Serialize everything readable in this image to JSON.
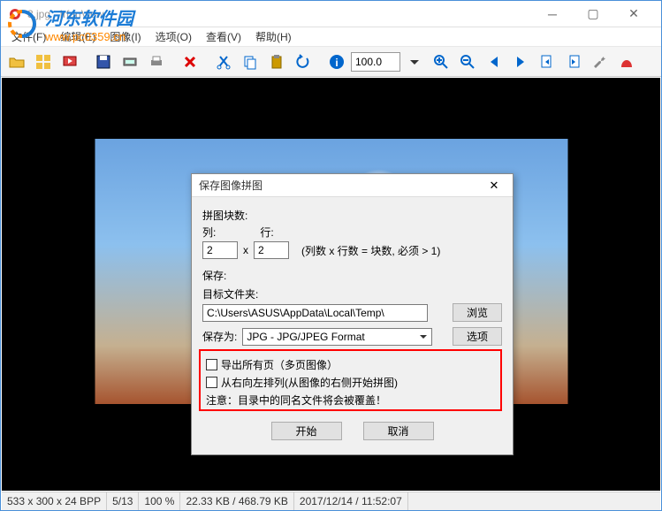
{
  "window": {
    "title": "3.jpg - IrfanView"
  },
  "menu": {
    "file": "文件(F)",
    "edit": "编辑(E)",
    "image": "图像(I)",
    "options": "选项(O)",
    "view": "查看(V)",
    "help": "帮助(H)"
  },
  "toolbar": {
    "zoom_value": "100.0"
  },
  "status": {
    "dims": "533 x 300 x 24 BPP",
    "index": "5/13",
    "zoom": "100 %",
    "size": "22.33 KB / 468.79 KB",
    "datetime": "2017/12/14 / 11:52:07"
  },
  "dialog": {
    "title": "保存图像拼图",
    "section_tiles": "拼图块数:",
    "cols_label": "列:",
    "rows_label": "行:",
    "cols_value": "2",
    "rows_value": "2",
    "tiles_hint": "(列数 x 行数 = 块数, 必须 > 1)",
    "x": "x",
    "section_save": "保存:",
    "folder_label": "目标文件夹:",
    "folder_value": "C:\\Users\\ASUS\\AppData\\Local\\Temp\\",
    "browse": "浏览",
    "saveas_label": "保存为:",
    "format": "JPG - JPG/JPEG Format",
    "options": "选项",
    "chk1": "导出所有页（多页图像）",
    "chk2": "从右向左排列(从图像的右侧开始拼图)",
    "warn": "注意：目录中的同名文件将会被覆盖！",
    "start": "开始",
    "cancel": "取消"
  },
  "watermark": {
    "title": "河东软件园",
    "url": "www.pc0359.cn"
  }
}
